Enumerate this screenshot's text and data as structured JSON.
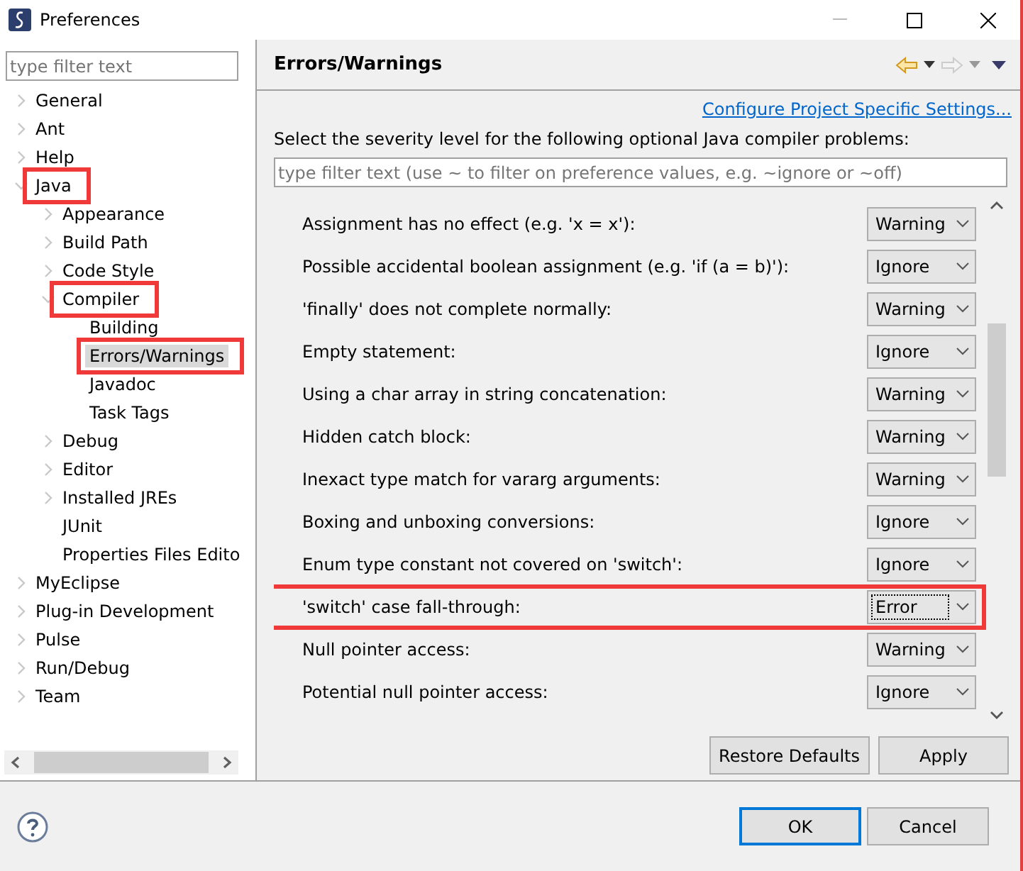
{
  "window": {
    "title": "Preferences"
  },
  "sidebar": {
    "filter": {
      "placeholder": "type filter text"
    },
    "tree": [
      {
        "label": "General",
        "expanded": false,
        "selected": false,
        "highlighted": false
      },
      {
        "label": "Ant",
        "expanded": false,
        "selected": false,
        "highlighted": false
      },
      {
        "label": "Help",
        "expanded": false,
        "selected": false,
        "highlighted": false
      },
      {
        "label": "Java",
        "expanded": true,
        "selected": false,
        "highlighted": true,
        "children": [
          {
            "label": "Appearance",
            "expanded": false,
            "selected": false,
            "highlighted": false
          },
          {
            "label": "Build Path",
            "expanded": false,
            "selected": false,
            "highlighted": false
          },
          {
            "label": "Code Style",
            "expanded": false,
            "selected": false,
            "highlighted": false
          },
          {
            "label": "Compiler",
            "expanded": true,
            "selected": false,
            "highlighted": true,
            "children": [
              {
                "label": "Building",
                "selected": false,
                "highlighted": false
              },
              {
                "label": "Errors/Warnings",
                "selected": true,
                "highlighted": true
              },
              {
                "label": "Javadoc",
                "selected": false,
                "highlighted": false
              },
              {
                "label": "Task Tags",
                "selected": false,
                "highlighted": false
              }
            ]
          },
          {
            "label": "Debug",
            "expanded": false,
            "selected": false,
            "highlighted": false
          },
          {
            "label": "Editor",
            "expanded": false,
            "selected": false,
            "highlighted": false
          },
          {
            "label": "Installed JREs",
            "expanded": false,
            "selected": false,
            "highlighted": false
          },
          {
            "label": "JUnit",
            "selected": false,
            "highlighted": false
          },
          {
            "label": "Properties Files Edito",
            "selected": false,
            "highlighted": false
          }
        ]
      },
      {
        "label": "MyEclipse",
        "expanded": false,
        "selected": false,
        "highlighted": false
      },
      {
        "label": "Plug-in Development",
        "expanded": false,
        "selected": false,
        "highlighted": false
      },
      {
        "label": "Pulse",
        "expanded": false,
        "selected": false,
        "highlighted": false
      },
      {
        "label": "Run/Debug",
        "expanded": false,
        "selected": false,
        "highlighted": false
      },
      {
        "label": "Team",
        "expanded": false,
        "selected": false,
        "highlighted": false
      }
    ]
  },
  "page": {
    "title": "Errors/Warnings",
    "link": "Configure Project Specific Settings...",
    "description": "Select the severity level for the following optional Java compiler problems:",
    "filter": {
      "placeholder": "type filter text (use ~ to filter on preference values, e.g. ~ignore or ~off)"
    },
    "problems": [
      {
        "label": "Assignment has no effect (e.g. 'x = x'):",
        "value": "Warning",
        "focused": false,
        "highlighted": false
      },
      {
        "label": "Possible accidental boolean assignment (e.g. 'if (a = b)'):",
        "value": "Ignore",
        "focused": false,
        "highlighted": false
      },
      {
        "label": "'finally' does not complete normally:",
        "value": "Warning",
        "focused": false,
        "highlighted": false
      },
      {
        "label": "Empty statement:",
        "value": "Ignore",
        "focused": false,
        "highlighted": false
      },
      {
        "label": "Using a char array in string concatenation:",
        "value": "Warning",
        "focused": false,
        "highlighted": false
      },
      {
        "label": "Hidden catch block:",
        "value": "Warning",
        "focused": false,
        "highlighted": false
      },
      {
        "label": "Inexact type match for vararg arguments:",
        "value": "Warning",
        "focused": false,
        "highlighted": false
      },
      {
        "label": "Boxing and unboxing conversions:",
        "value": "Ignore",
        "focused": false,
        "highlighted": false
      },
      {
        "label": "Enum type constant not covered on 'switch':",
        "value": "Ignore",
        "focused": false,
        "highlighted": false
      },
      {
        "label": "'switch' case fall-through:",
        "value": "Error",
        "focused": true,
        "highlighted": true
      },
      {
        "label": "Null pointer access:",
        "value": "Warning",
        "focused": false,
        "highlighted": false
      },
      {
        "label": "Potential null pointer access:",
        "value": "Ignore",
        "focused": false,
        "highlighted": false
      }
    ],
    "buttons": [
      "Restore Defaults",
      "Apply"
    ]
  },
  "footer": {
    "buttons": [
      {
        "label": "OK",
        "default": true
      },
      {
        "label": "Cancel",
        "default": false
      }
    ]
  }
}
